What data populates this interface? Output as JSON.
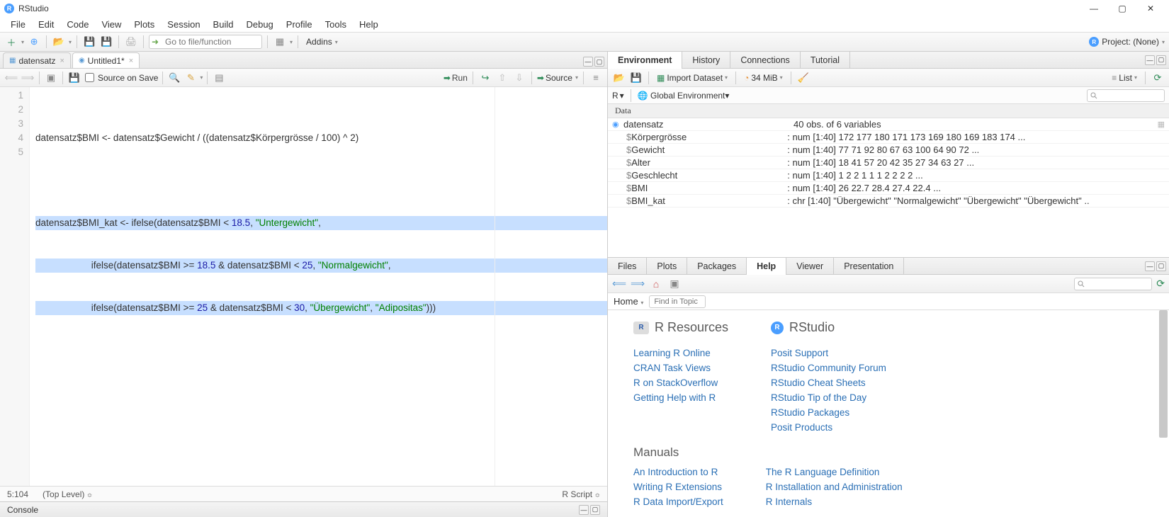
{
  "app": {
    "title": "RStudio"
  },
  "window_buttons": {
    "min": "—",
    "max": "▢",
    "close": "✕"
  },
  "menubar": [
    "File",
    "Edit",
    "Code",
    "View",
    "Plots",
    "Session",
    "Build",
    "Debug",
    "Profile",
    "Tools",
    "Help"
  ],
  "main_toolbar": {
    "goto_placeholder": "Go to file/function",
    "addins": "Addins",
    "project_label": "Project: (None)"
  },
  "source": {
    "tabs": [
      {
        "label": "datensatz",
        "icon": "table",
        "close": true
      },
      {
        "label": "Untitled1*",
        "icon": "doc",
        "close": true,
        "active": true
      }
    ],
    "toolbar": {
      "source_on_save": "Source on Save",
      "run": "Run",
      "source": "Source"
    },
    "lines": [
      1,
      2,
      3,
      4,
      5
    ],
    "code": {
      "l1": "datensatz$BMI <- datensatz$Gewicht / ((datensatz$Körpergrösse / 100) ^ 2)",
      "l3a": "datensatz$BMI_kat <- ifelse(datensatz$BMI < ",
      "l3n1": "18.5",
      "l3b": ", ",
      "l3s": "\"Untergewicht\"",
      "l3c": ",",
      "l4a": "                     ifelse(datensatz$BMI >= ",
      "l4n1": "18.5",
      "l4b": " & datensatz$BMI < ",
      "l4n2": "25",
      "l4c": ", ",
      "l4s": "\"Normalgewicht\"",
      "l4d": ",",
      "l5a": "                     ifelse(datensatz$BMI >= ",
      "l5n1": "25",
      "l5b": " & datensatz$BMI < ",
      "l5n2": "30",
      "l5c": ", ",
      "l5s1": "\"Übergewicht\"",
      "l5d": ", ",
      "l5s2": "\"Adipositas\"",
      "l5e": ")))"
    },
    "status": {
      "pos": "5:104",
      "scope": "(Top Level)",
      "lang": "R Script"
    }
  },
  "console": {
    "label": "Console"
  },
  "env": {
    "tabs": [
      "Environment",
      "History",
      "Connections",
      "Tutorial"
    ],
    "active": 0,
    "import": "Import Dataset",
    "mem": "34 MiB",
    "list": "List",
    "scope_r": "R",
    "scope_global": "Global Environment",
    "data_header": "Data",
    "object": {
      "name": "datensatz",
      "summary": "40 obs. of  6 variables"
    },
    "vars": [
      {
        "name": "Körpergrösse",
        "desc": ": num [1:40] 172 177 180 171 173 169 180 169 183 174 ..."
      },
      {
        "name": "Gewicht",
        "desc": ": num [1:40] 77 71 92 80 67 63 100 64 90 72 ..."
      },
      {
        "name": "Alter",
        "desc": ": num [1:40] 18 41 57 20 42 35 27 34 63 27 ..."
      },
      {
        "name": "Geschlecht",
        "desc": ": num [1:40] 1 2 2 1 1 1 2 2 2 2 ..."
      },
      {
        "name": "BMI",
        "desc": ": num [1:40] 26 22.7 28.4 27.4 22.4 ..."
      },
      {
        "name": "BMI_kat",
        "desc": ": chr [1:40] \"Übergewicht\" \"Normalgewicht\" \"Übergewicht\" \"Übergewicht\" .."
      }
    ]
  },
  "help": {
    "tabs": [
      "Files",
      "Plots",
      "Packages",
      "Help",
      "Viewer",
      "Presentation"
    ],
    "active": 3,
    "home": "Home",
    "find_placeholder": "Find in Topic",
    "sections": {
      "r_resources": "R Resources",
      "rstudio": "RStudio",
      "manuals": "Manuals"
    },
    "links_left": [
      "Learning R Online",
      "CRAN Task Views",
      "R on StackOverflow",
      "Getting Help with R"
    ],
    "links_right": [
      "Posit Support",
      "RStudio Community Forum",
      "RStudio Cheat Sheets",
      "RStudio Tip of the Day",
      "RStudio Packages",
      "Posit Products"
    ],
    "manuals_left": [
      "An Introduction to R",
      "Writing R Extensions",
      "R Data Import/Export"
    ],
    "manuals_right": [
      "The R Language Definition",
      "R Installation and Administration",
      "R Internals"
    ]
  }
}
